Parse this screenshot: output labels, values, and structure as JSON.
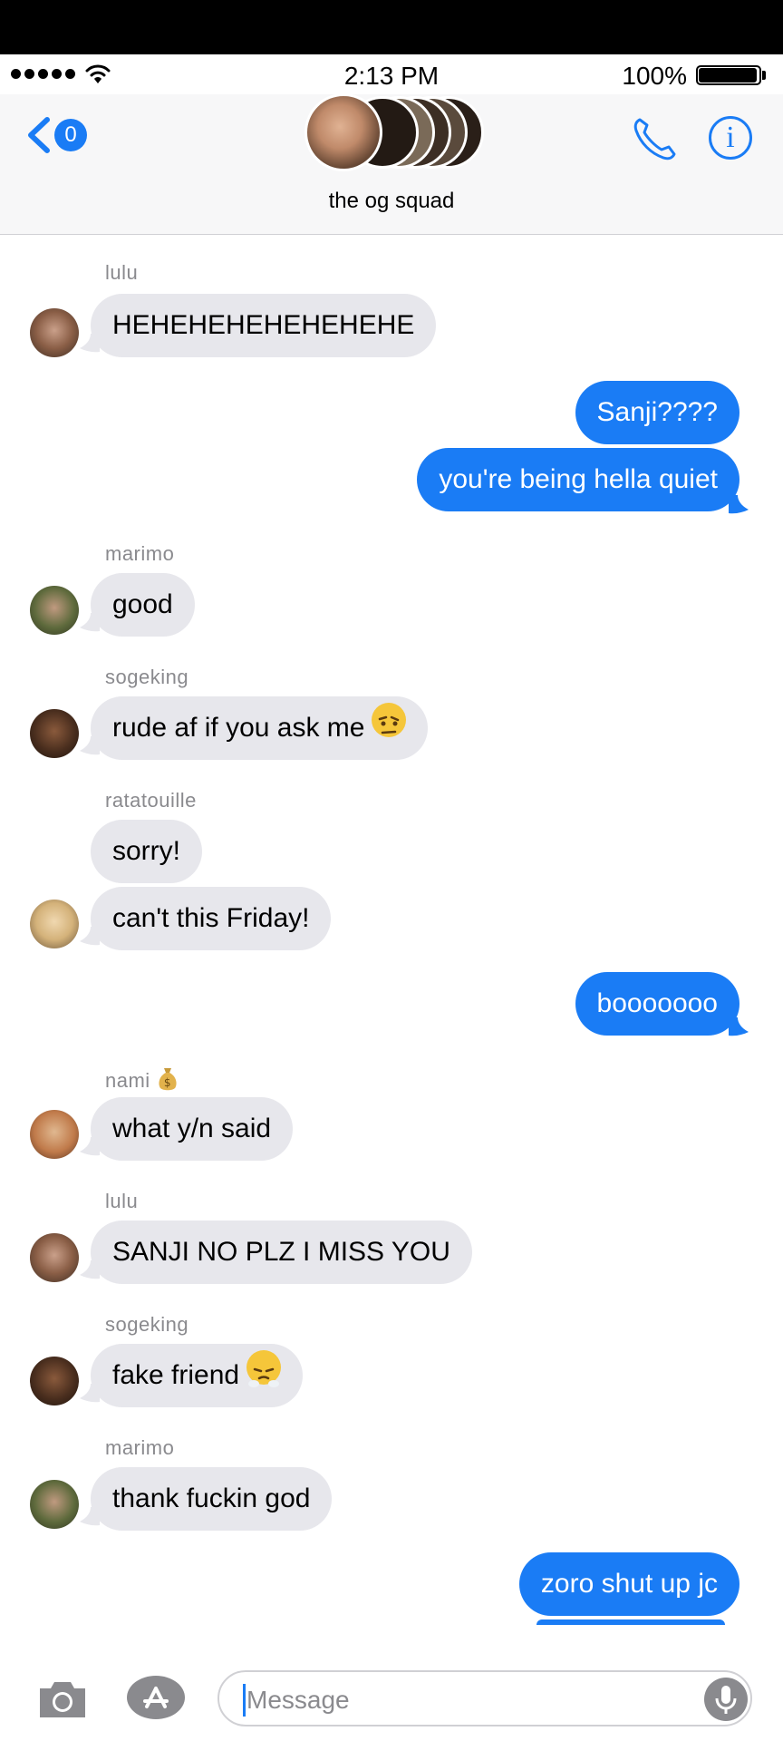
{
  "status_bar": {
    "time": "2:13 PM",
    "battery": "100%"
  },
  "header": {
    "back_badge": "0",
    "title": "the og squad"
  },
  "colors": {
    "accent": "#1a7cf5",
    "incoming_bubble": "#e7e7ec",
    "sender_label": "#8a8a8e"
  },
  "messages": [
    {
      "sender": "lulu",
      "text": "HEHEHEHEHEHEHEHE"
    },
    {
      "text": "Sanji????"
    },
    {
      "text": "you're being hella quiet"
    },
    {
      "sender": "marimo",
      "text": "good"
    },
    {
      "sender": "sogeking",
      "text": "rude af if you ask me"
    },
    {
      "sender": "ratatouille",
      "text": "sorry!"
    },
    {
      "text": "can't this Friday!"
    },
    {
      "text": "booooooo"
    },
    {
      "sender": "nami",
      "text": "what y/n said"
    },
    {
      "sender": "lulu",
      "text": "SANJI NO PLZ I MISS YOU"
    },
    {
      "sender": "sogeking",
      "text": "fake friend"
    },
    {
      "sender": "marimo",
      "text": "thank fuckin god"
    },
    {
      "text": "zoro shut up jc"
    }
  ],
  "composer": {
    "placeholder": "Message"
  }
}
